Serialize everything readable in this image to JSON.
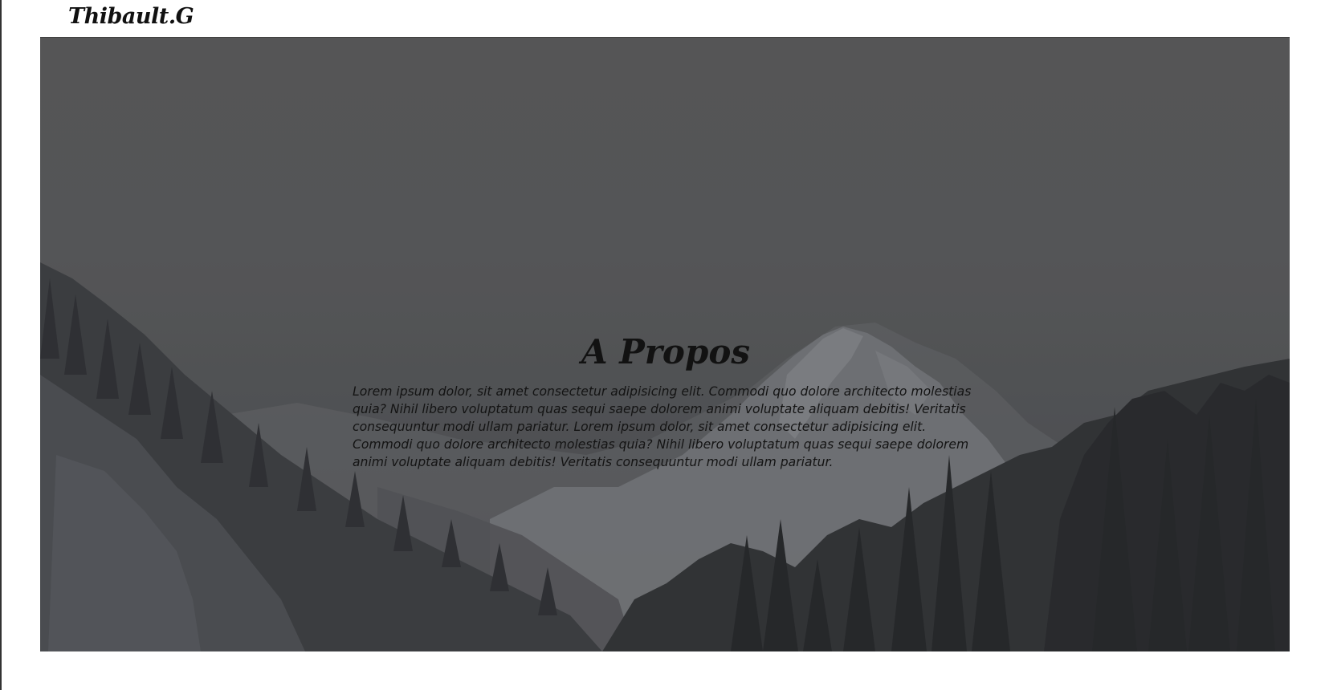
{
  "header": {
    "logo": "Thibault.G"
  },
  "hero": {
    "background_description_icon": "mountain-landscape-image",
    "title": "A Propos",
    "body": "Lorem ipsum dolor, sit amet consectetur adipisicing elit. Commodi quo dolore architecto molestias quia? Nihil libero voluptatum quas sequi saepe dolorem animi voluptate aliquam debitis! Veritatis consequuntur modi ullam pariatur. Lorem ipsum dolor, sit amet consectetur adipisicing elit. Commodi quo dolore architecto molestias quia? Nihil libero voluptatum quas sequi saepe dolorem animi voluptate aliquam debitis! Veritatis consequuntur modi ullam pariatur."
  },
  "colors": {
    "page_background": "#ffffff",
    "hero_overlay": "#5a5a5c",
    "text": "#121212"
  }
}
